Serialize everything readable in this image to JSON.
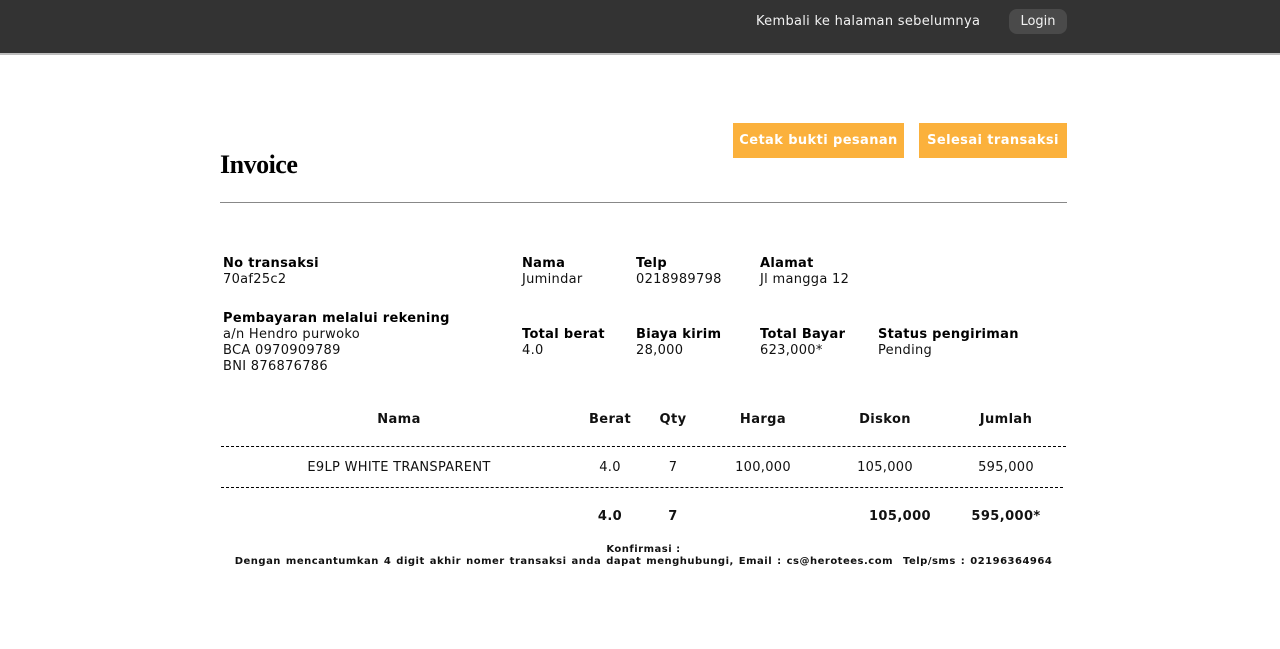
{
  "nav": {
    "back_label": "Kembali ke halaman sebelumnya",
    "login_label": "Login"
  },
  "actions": {
    "print_label": "Cetak bukti pesanan",
    "finish_label": "Selesai transaksi"
  },
  "page": {
    "title": "Invoice"
  },
  "details": {
    "transaction": {
      "label": "No transaksi",
      "value": "70af25c2"
    },
    "name": {
      "label": "Nama",
      "value": "Jumindar"
    },
    "phone": {
      "label": "Telp",
      "value": "0218989798"
    },
    "address": {
      "label": "Alamat",
      "value": "Jl mangga 12"
    },
    "payment": {
      "label": "Pembayaran melalui rekening",
      "lines": [
        "a/n Hendro purwoko",
        "BCA 0970909789",
        "BNI 876876786"
      ]
    },
    "total_weight": {
      "label": "Total berat",
      "value": "4.0"
    },
    "shipping_cost": {
      "label": "Biaya kirim",
      "value": "28,000"
    },
    "total_pay": {
      "label": "Total Bayar",
      "value": "623,000*"
    },
    "shipping_status": {
      "label": "Status pengiriman",
      "value": "Pending"
    }
  },
  "table": {
    "headers": {
      "name": "Nama",
      "weight": "Berat",
      "qty": "Qty",
      "price": "Harga",
      "discount": "Diskon",
      "amount": "Jumlah"
    },
    "rows": [
      {
        "name": "E9LP WHITE TRANSPARENT",
        "weight": "4.0",
        "qty": "7",
        "price": "100,000",
        "discount": "105,000",
        "amount": "595,000"
      }
    ],
    "totals": {
      "weight": "4.0",
      "qty": "7",
      "discount": "105,000",
      "amount": "595,000*"
    }
  },
  "footer": {
    "title": "Konfirmasi :",
    "text": "Dengan mencantumkan 4 digit akhir nomer transaksi anda dapat menghubungi, Email : cs@herotees.com  Telp/sms : 02196364964"
  },
  "colors": {
    "topbar": "#333333",
    "accent": "#fbb13c"
  }
}
